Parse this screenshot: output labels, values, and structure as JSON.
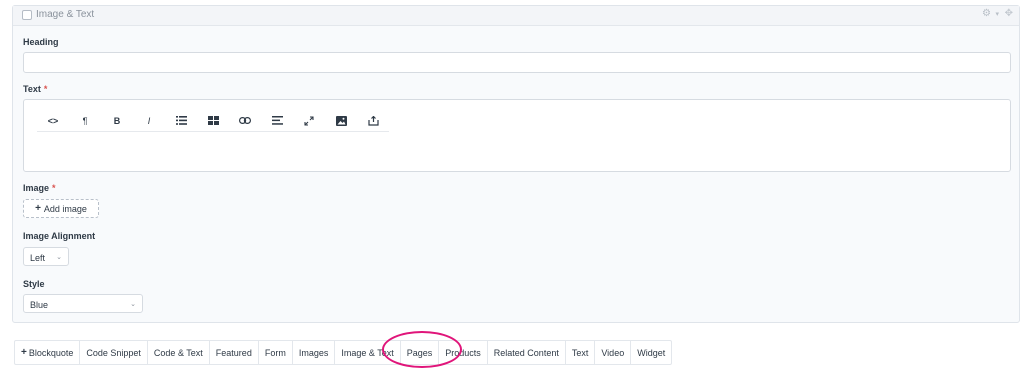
{
  "block": {
    "title": "Image & Text",
    "icons": {
      "settings": "gear-icon",
      "dropdown": "chevron-down-icon",
      "move": "move-icon"
    }
  },
  "fields": {
    "heading": {
      "label": "Heading",
      "value": ""
    },
    "text": {
      "label": "Text",
      "required_mark": "*",
      "value": ""
    },
    "image": {
      "label": "Image",
      "required_mark": "*",
      "add_label": "Add image"
    },
    "alignment": {
      "label": "Image Alignment",
      "selected": "Left"
    },
    "style": {
      "label": "Style",
      "selected": "Blue"
    }
  },
  "toolbar": {
    "buttons": [
      {
        "name": "code-view",
        "icon": "code-icon",
        "glyph": "<>"
      },
      {
        "name": "paragraph",
        "icon": "pilcrow-icon",
        "glyph": "¶"
      },
      {
        "name": "bold",
        "icon": "bold-icon",
        "glyph": "B"
      },
      {
        "name": "italic",
        "icon": "italic-icon",
        "glyph": "I"
      },
      {
        "name": "bullet-list",
        "icon": "list-icon",
        "glyph": "list"
      },
      {
        "name": "table",
        "icon": "table-icon",
        "glyph": "table"
      },
      {
        "name": "link",
        "icon": "link-icon",
        "glyph": "link"
      },
      {
        "name": "align",
        "icon": "align-icon",
        "glyph": "align"
      },
      {
        "name": "fullscreen",
        "icon": "expand-icon",
        "glyph": "expand"
      },
      {
        "name": "image",
        "icon": "image-icon",
        "glyph": "image"
      },
      {
        "name": "embed",
        "icon": "embed-icon",
        "glyph": "embed"
      }
    ]
  },
  "tabs": [
    {
      "label": "Blockquote",
      "has_plus": true
    },
    {
      "label": "Code Snippet"
    },
    {
      "label": "Code & Text"
    },
    {
      "label": "Featured"
    },
    {
      "label": "Form"
    },
    {
      "label": "Images"
    },
    {
      "label": "Image & Text",
      "highlighted": true
    },
    {
      "label": "Pages"
    },
    {
      "label": "Products"
    },
    {
      "label": "Related Content"
    },
    {
      "label": "Text"
    },
    {
      "label": "Video"
    },
    {
      "label": "Widget"
    }
  ],
  "colors": {
    "highlight_circle": "#e0157a",
    "required": "#d9534f"
  }
}
